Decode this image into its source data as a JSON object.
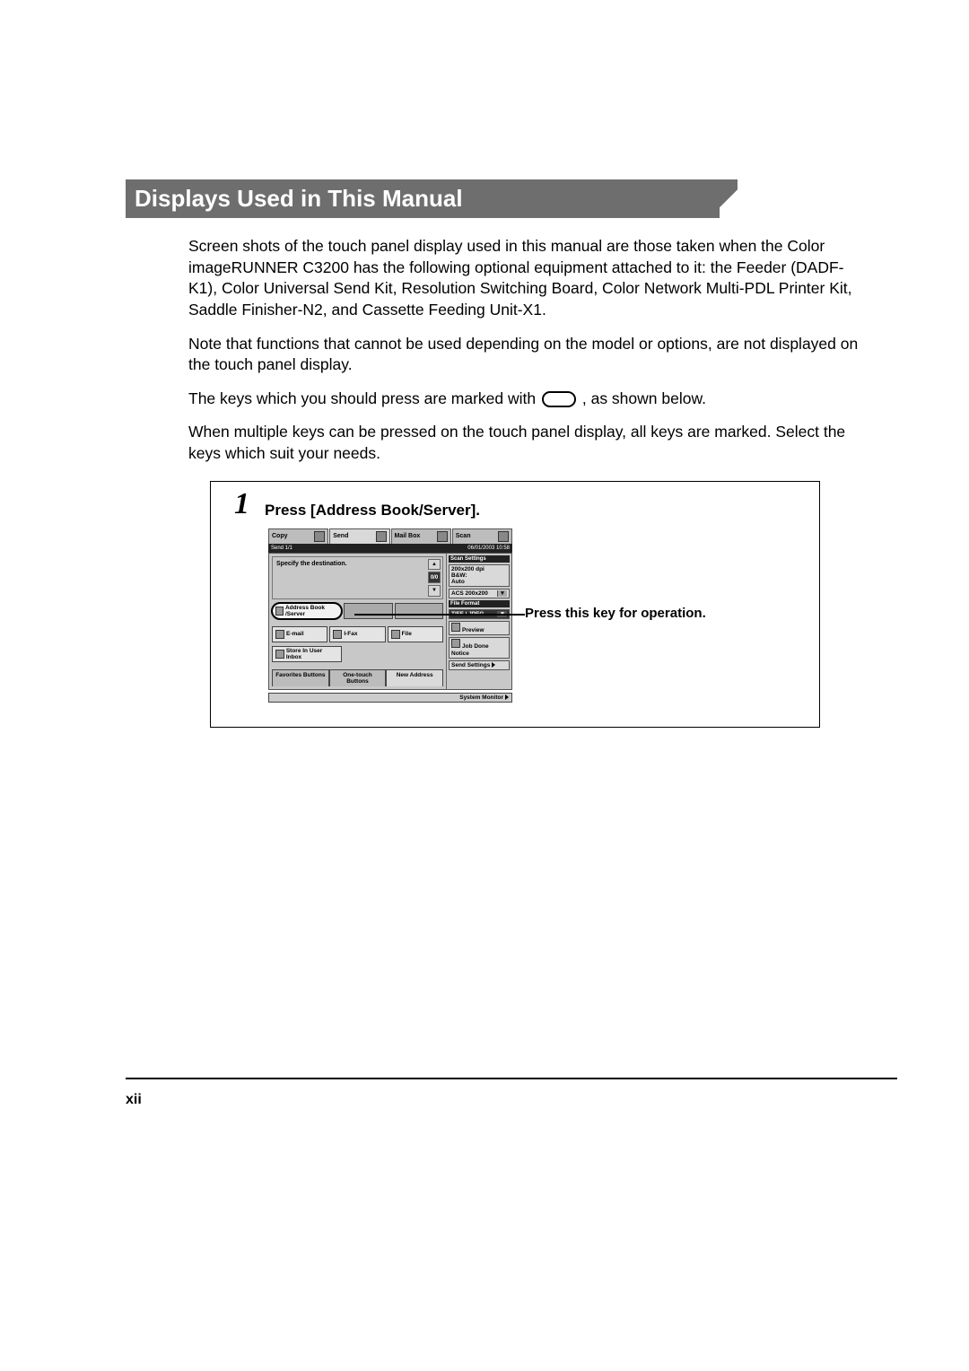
{
  "heading": "Displays Used in This Manual",
  "paragraphs": {
    "p1": "Screen shots of the touch panel display used in this manual are those taken when the Color imageRUNNER C3200 has the following optional equipment attached to it: the Feeder (DADF-K1), Color Universal Send Kit, Resolution Switching Board, Color Network Multi-PDL Printer Kit, Saddle Finisher-N2, and Cassette Feeding Unit-X1.",
    "p2": "Note that functions that cannot be used depending on the model or options, are not displayed on the touch panel display.",
    "p3a": "The keys which you should press are marked with ",
    "p3b": ", as shown below.",
    "p4": "When multiple keys can be pressed on the touch panel display, all keys are marked. Select the keys which suit your needs."
  },
  "figure": {
    "step_number": "1",
    "step_title": "Press [Address Book/Server].",
    "callout": "Press this key for operation."
  },
  "panel": {
    "tabs": [
      "Copy",
      "Send",
      "Mail Box",
      "Scan"
    ],
    "status_left": "Send 1/1",
    "status_right": "06/01/2003 10:58",
    "scan_header": "Scan Settings",
    "destination_prompt": "Specify the destination.",
    "arrow_up": "▲",
    "arrow_down": "▼",
    "address_book": "Address Book /Server",
    "email": "E-mail",
    "ifax": "I-Fax",
    "file": "File",
    "store_in": "Store In User Inbox",
    "bottom_tabs": [
      "Favorites Buttons",
      "One-touch Buttons",
      "New Address"
    ],
    "resolution": "200x200 dpi",
    "scan_mode_label": "B&W:",
    "scan_mode_value": "Auto",
    "aces": "ACS 200x200",
    "file_format_header": "File Format",
    "file_format": "TIFF / JPEG",
    "preview": "Preview",
    "job_done": "Job Done Notice",
    "send_settings": "Send Settings",
    "system_monitor": "System Monitor"
  },
  "page_number": "xii"
}
